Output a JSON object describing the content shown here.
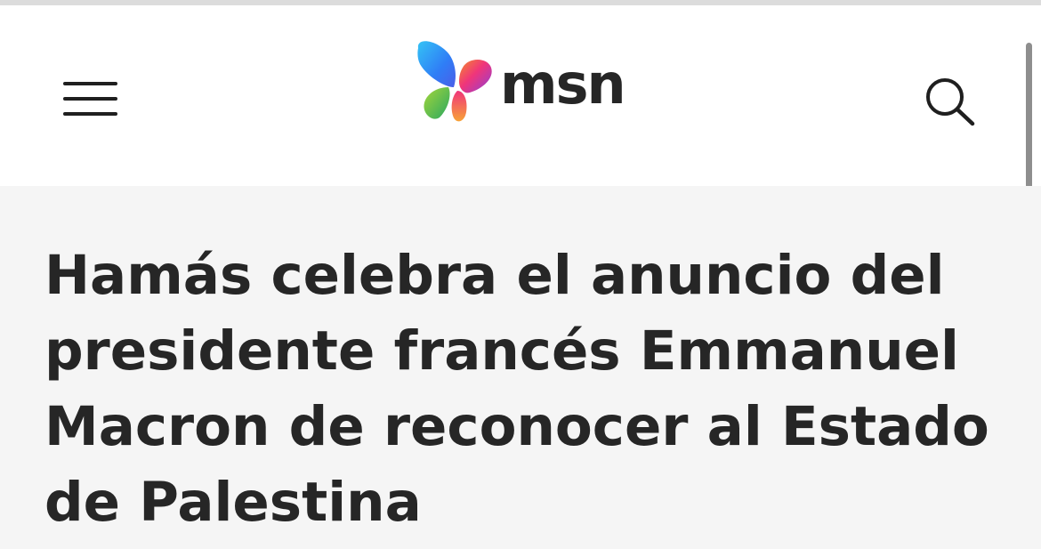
{
  "header": {
    "logo_text": "msn",
    "menu_icon": "hamburger-menu-icon",
    "search_icon": "search-icon",
    "brand_colors": [
      "#2f7df6",
      "#8d3fd8",
      "#f0357a",
      "#f58b2b",
      "#46b85a"
    ]
  },
  "article": {
    "headline": "Hamás celebra el anuncio del presidente francés Emmanuel Macron de reconocer al Estado de Palestina"
  }
}
